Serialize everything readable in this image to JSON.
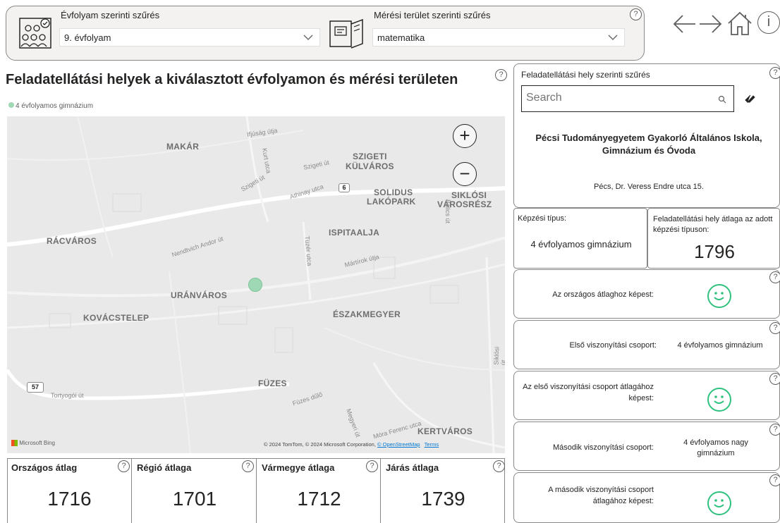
{
  "filters": {
    "grade": {
      "label": "Évfolyam szerinti szűrés",
      "value": "9. évfolyam"
    },
    "area": {
      "label": "Mérési terület szerinti szűrés",
      "value": "matematika"
    },
    "help": "?"
  },
  "nav": {
    "back": "←",
    "forward": "→",
    "info": "i"
  },
  "map": {
    "title": "Feladatellátási helyek a kiválasztott évfolyamon és mérési területen",
    "legend": "4 évfolyamos gimnázium",
    "zoom_in": "+",
    "zoom_out": "−",
    "attribution": "© 2024 TomTom, © 2024 Microsoft Corporation,",
    "osm": "© OpenStreetMap",
    "terms": "Terms",
    "bing": "Microsoft Bing",
    "route_badge_57": "57",
    "route_badge_6": "6",
    "districts": [
      "MAKÁR",
      "SZIGETI",
      "KÜLVÁROS",
      "SOLIDUS",
      "LAKÓPARK",
      "SIKLÓSI",
      "VÁROSRÉSZ",
      "RÁCVÁROS",
      "ISPITAALJA",
      "URÁNVÁROS",
      "KOVÁCSTELEP",
      "ÉSZAKMEGYER",
      "FÜZES",
      "KERTVÁROS"
    ],
    "streets": [
      "Ifjúság útja",
      "Kurt utca",
      "Szigeti út",
      "Szigeti út",
      "Athinay utca",
      "Nendtvich Andor út",
      "Tüzér utca",
      "Mártírok útja",
      "Tortyogói út",
      "Füzes dűlő",
      "Megyeri út",
      "Móra Ferenc utca",
      "Siklósi út",
      "Bálics út"
    ]
  },
  "kpis": [
    {
      "label": "Országos átlag",
      "value": "1716"
    },
    {
      "label": "Régió átlaga",
      "value": "1701"
    },
    {
      "label": "Vármegye átlaga",
      "value": "1712"
    },
    {
      "label": "Járás átlaga",
      "value": "1739"
    }
  ],
  "right": {
    "filter_title": "Feladatellátási hely szerinti szűrés",
    "search_placeholder": "Search",
    "school_name": "Pécsi Tudományegyetem Gyakorló Általános Iskola, Gimnázium és Óvoda",
    "address": "Pécs, Dr. Veress Endre utca 15.",
    "training_type_label": "Képzési típus:",
    "training_type_value": "4 évfolyamos gimnázium",
    "site_avg_label": "Feladatellátási hely átlaga az adott képzési típuson:",
    "site_avg_value": "1796",
    "national_compare_label": "Az országos átlaghoz képest:",
    "group1_label": "Első viszonyítási csoport:",
    "group1_value": "4 évfolyamos gimnázium",
    "group1_compare_label": "Az első viszonyítási csoport átlagához képest:",
    "group2_label": "Második viszonyítási csoport:",
    "group2_value": "4 évfolyamos nagy gimnázium",
    "group2_compare_label": "A második viszonyítási csoport átlagához képest:"
  },
  "colors": {
    "accent_green": "#2ec27e",
    "marker": "#9fd8b4"
  }
}
